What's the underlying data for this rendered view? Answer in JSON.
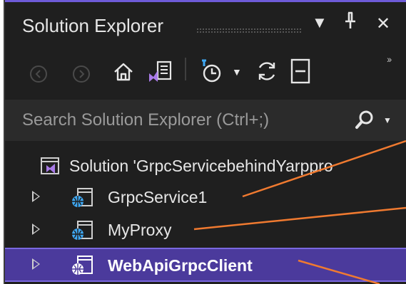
{
  "panel": {
    "title": "Solution Explorer",
    "title_buttons": {
      "dropdown_glyph": "▼",
      "pin_glyph": "⊥",
      "close_glyph": "✕"
    }
  },
  "toolbar": {
    "icons": [
      "back-icon",
      "forward-icon",
      "home-icon",
      "switch-views-icon",
      "pending-changes-icon",
      "sync-icon",
      "collapse-all-icon"
    ],
    "overflow_glyph": "››"
  },
  "search": {
    "placeholder": "Search Solution Explorer (Ctrl+;)",
    "value": ""
  },
  "tree": {
    "solution_label": "Solution 'GrpcServicebehindYarppro",
    "projects": [
      {
        "label": "GrpcService1",
        "selected": false
      },
      {
        "label": "MyProxy",
        "selected": false
      },
      {
        "label": "WebApiGrpcClient",
        "selected": true
      }
    ]
  },
  "colors": {
    "accent": "#6e5bd8",
    "selection": "#4b3a9c",
    "annotation_lines": "#f07a30",
    "project_icon_blue": "#3fa9f5"
  }
}
